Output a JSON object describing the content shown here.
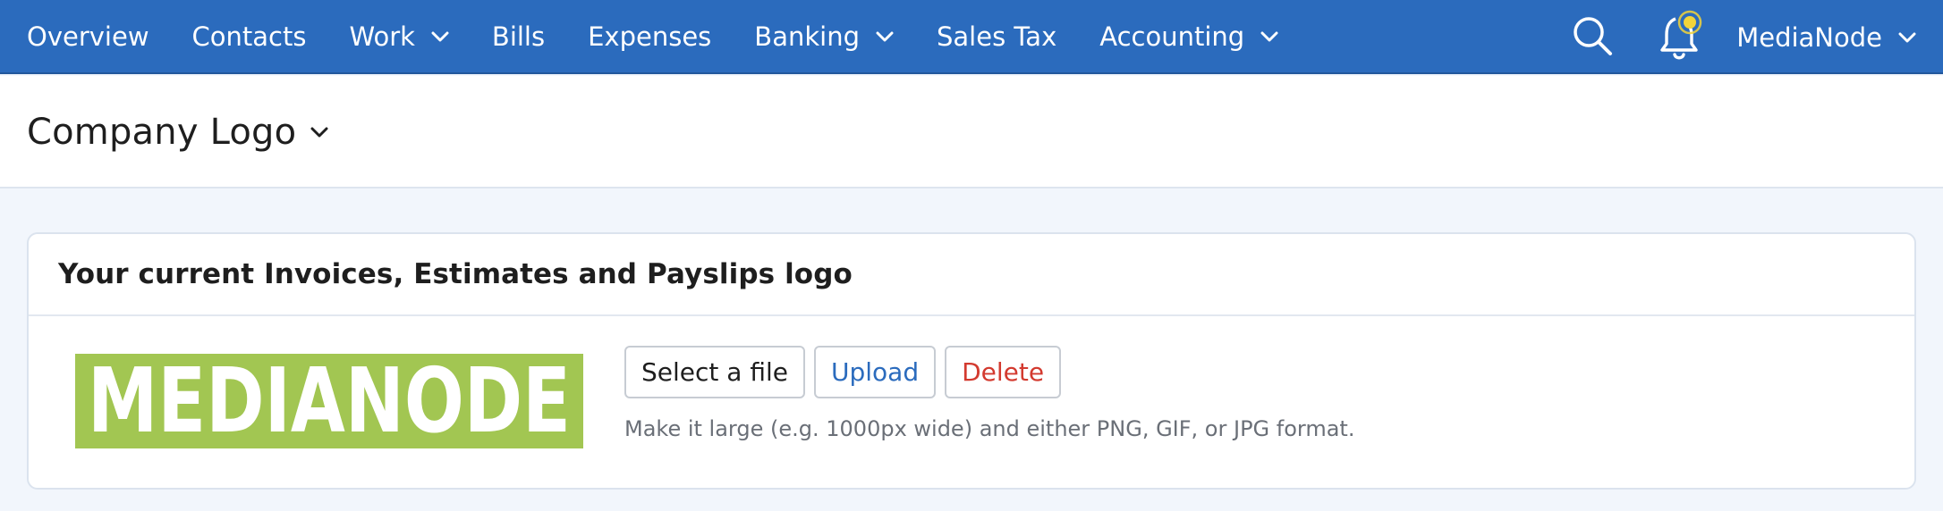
{
  "nav": {
    "items": [
      {
        "label": "Overview",
        "dropdown": false
      },
      {
        "label": "Contacts",
        "dropdown": false
      },
      {
        "label": "Work",
        "dropdown": true
      },
      {
        "label": "Bills",
        "dropdown": false
      },
      {
        "label": "Expenses",
        "dropdown": false
      },
      {
        "label": "Banking",
        "dropdown": true
      },
      {
        "label": "Sales Tax",
        "dropdown": false
      },
      {
        "label": "Accounting",
        "dropdown": true
      }
    ],
    "account_label": "MediaNode",
    "icons": {
      "search": "search-icon",
      "notifications": "bell-icon"
    },
    "notification_badge_color": "#f2d43a"
  },
  "page": {
    "title": "Company Logo"
  },
  "logo_card": {
    "heading": "Your current Invoices, Estimates and Payslips logo",
    "logo_text": "MEDIANODE",
    "buttons": {
      "select": "Select a file",
      "upload": "Upload",
      "delete": "Delete"
    },
    "hint": "Make it large (e.g. 1000px wide) and either PNG, GIF, or JPG format."
  },
  "colors": {
    "topbar": "#2b6bbd",
    "logo_background": "#a2c652",
    "upload_text": "#2b6bbd",
    "delete_text": "#d33a2f"
  }
}
